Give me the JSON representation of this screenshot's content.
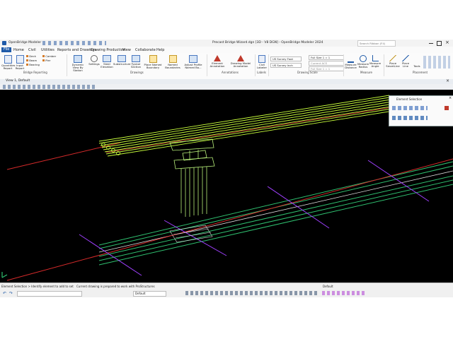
{
  "titlebar": {
    "app": "OpenBridge Modeler",
    "title": "Precast Bridge Wizard.dgn [3D - V8 DGN] - OpenBridge Modeler 2024",
    "search_placeholder": "Search Ribbon (F4)"
  },
  "menu": [
    "File",
    "Home",
    "Civil",
    "Utilities",
    "Reports and Drawings",
    "Drawing Production",
    "View",
    "Collaborate",
    "Help"
  ],
  "ribbon": {
    "bridge_reporting": {
      "label": "Bridge Reporting",
      "quantities": "Quantities Report",
      "input": "Input Report",
      "deck": "Deck",
      "beam": "Beam",
      "bearing": "Bearing",
      "camber": "Camber",
      "pier": "Pier"
    },
    "drawings": {
      "label": "Drawings",
      "dynamic": "Dynamic View By Station",
      "settings": "Settings",
      "steel": "Steel Elevation",
      "sub": "Substructure",
      "typical": "Typical Section",
      "place_named": "Place Named Boundary",
      "named_boundaries": "Named Boundaries",
      "adjust": "Adjust Profile Named Bo..."
    },
    "annotations": {
      "label": "Annotations",
      "element": "Element Annotation",
      "drawing": "Drawing Model Annotation"
    },
    "labels": {
      "label": "Labels",
      "civil": "Civil Labeler"
    },
    "drawing_scale": {
      "label": "Drawing Scale",
      "unit1": "US Survey Foot",
      "unit2": "US Survey Inch",
      "scale1": "Full Size 1 = 1",
      "acs": "Current ACS",
      "scale2": "Full Size 1 = 1"
    },
    "measure": {
      "label": "Measure",
      "distance": "Measure Distance",
      "radius": "Measure Radius",
      "angle": "Measure Angle"
    },
    "placement": {
      "label": "Placement",
      "smartline": "Place SmartLine",
      "line": "Place Line",
      "tools": "Tools"
    }
  },
  "view": {
    "title": "View 1, Default"
  },
  "element_selection": {
    "title": "Element Selection"
  },
  "status": {
    "tool": "Element Selection > Identify element to add to set",
    "message": "Current drawing is prepared to work with ProStructures",
    "model": "Default",
    "level": "Default"
  },
  "colors": {
    "accent": "#1f5aa8",
    "viewport": "#000000",
    "girder": "#c9ff3c",
    "alignment": "#d42a2a",
    "pier": "#b8f07a",
    "road": "#2fbf6f",
    "station": "#a040ff"
  }
}
